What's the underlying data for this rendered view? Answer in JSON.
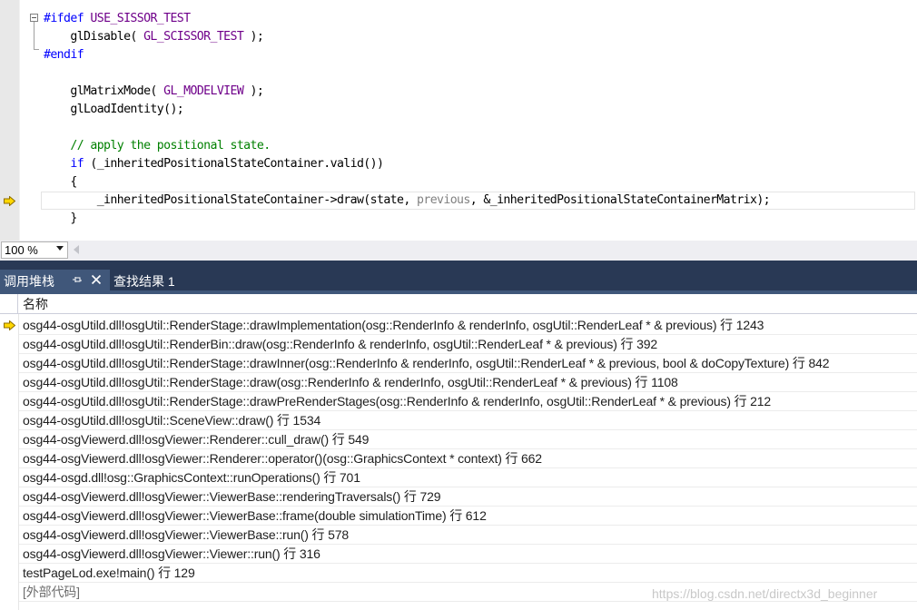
{
  "editor": {
    "lines": [
      {
        "tokens": [
          {
            "t": "#ifdef",
            "c": "tok-kw"
          },
          {
            "t": " USE_SISSOR_TEST",
            "c": "tok-mac"
          }
        ]
      },
      {
        "tokens": [
          {
            "t": "    glDisable( ",
            "c": ""
          },
          {
            "t": "GL_SCISSOR_TEST",
            "c": "tok-mac"
          },
          {
            "t": " );",
            "c": ""
          }
        ]
      },
      {
        "tokens": [
          {
            "t": "#endif",
            "c": "tok-kw"
          }
        ]
      },
      {
        "tokens": []
      },
      {
        "tokens": [
          {
            "t": "    glMatrixMode( ",
            "c": ""
          },
          {
            "t": "GL_MODELVIEW",
            "c": "tok-mac"
          },
          {
            "t": " );",
            "c": ""
          }
        ]
      },
      {
        "tokens": [
          {
            "t": "    glLoadIdentity();",
            "c": ""
          }
        ]
      },
      {
        "tokens": []
      },
      {
        "tokens": [
          {
            "t": "    // apply the positional state.",
            "c": "tok-cm"
          }
        ]
      },
      {
        "tokens": [
          {
            "t": "    ",
            "c": ""
          },
          {
            "t": "if",
            "c": "tok-kw"
          },
          {
            "t": " (_inheritedPositionalStateContainer.valid())",
            "c": ""
          }
        ]
      },
      {
        "tokens": [
          {
            "t": "    {",
            "c": ""
          }
        ]
      },
      {
        "tokens": [
          {
            "t": "        _inheritedPositionalStateContainer->draw(state, ",
            "c": ""
          },
          {
            "t": "previous",
            "c": "tok-par"
          },
          {
            "t": ", &_inheritedPositionalStateContainerMatrix);",
            "c": ""
          }
        ]
      },
      {
        "tokens": [
          {
            "t": "    }",
            "c": ""
          }
        ]
      }
    ],
    "current_line_index": 10,
    "current_line_marker_icon": "current-statement-arrow-icon"
  },
  "zoom": {
    "value": "100 %"
  },
  "panel": {
    "tabs": [
      {
        "label": "调用堆栈",
        "active": true
      },
      {
        "label": "查找结果 1",
        "active": false
      }
    ],
    "pin_icon": "pin-icon",
    "close_icon": "close-icon",
    "column_header": "名称",
    "frames": [
      {
        "text": "osg44-osgUtild.dll!osgUtil::RenderStage::drawImplementation(osg::RenderInfo & renderInfo, osgUtil::RenderLeaf * & previous) 行 1243",
        "current": true
      },
      {
        "text": "osg44-osgUtild.dll!osgUtil::RenderBin::draw(osg::RenderInfo & renderInfo, osgUtil::RenderLeaf * & previous) 行 392"
      },
      {
        "text": "osg44-osgUtild.dll!osgUtil::RenderStage::drawInner(osg::RenderInfo & renderInfo, osgUtil::RenderLeaf * & previous, bool & doCopyTexture) 行 842"
      },
      {
        "text": "osg44-osgUtild.dll!osgUtil::RenderStage::draw(osg::RenderInfo & renderInfo, osgUtil::RenderLeaf * & previous) 行 1108"
      },
      {
        "text": "osg44-osgUtild.dll!osgUtil::RenderStage::drawPreRenderStages(osg::RenderInfo & renderInfo, osgUtil::RenderLeaf * & previous) 行 212"
      },
      {
        "text": "osg44-osgUtild.dll!osgUtil::SceneView::draw() 行 1534"
      },
      {
        "text": "osg44-osgViewerd.dll!osgViewer::Renderer::cull_draw() 行 549"
      },
      {
        "text": "osg44-osgViewerd.dll!osgViewer::Renderer::operator()(osg::GraphicsContext * context) 行 662"
      },
      {
        "text": "osg44-osgd.dll!osg::GraphicsContext::runOperations() 行 701"
      },
      {
        "text": "osg44-osgViewerd.dll!osgViewer::ViewerBase::renderingTraversals() 行 729"
      },
      {
        "text": "osg44-osgViewerd.dll!osgViewer::ViewerBase::frame(double simulationTime) 行 612"
      },
      {
        "text": "osg44-osgViewerd.dll!osgViewer::ViewerBase::run() 行 578"
      },
      {
        "text": "osg44-osgViewerd.dll!osgViewer::Viewer::run() 行 316"
      },
      {
        "text": "testPageLod.exe!main() 行 129"
      },
      {
        "text": "[外部代码]",
        "external": true
      }
    ]
  },
  "watermark": "https://blog.csdn.net/directx3d_beginner",
  "colors": {
    "tab_bar": "#293955",
    "active_tab": "#40577a",
    "keyword": "#0000ff",
    "macro": "#6f008a",
    "comment": "#008000",
    "arrow_fill": "#ffd700"
  }
}
